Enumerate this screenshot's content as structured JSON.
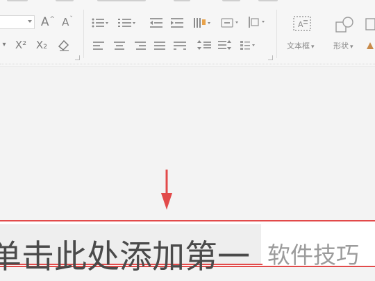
{
  "ribbon": {
    "font_group": {
      "font_size_value": "",
      "grow_font_label": "A",
      "shrink_font_label": "A",
      "superscript_label": "X²",
      "subscript_label": "X₂"
    },
    "insert_group": {
      "textbox_label": "文本框",
      "shape_label": "形状"
    }
  },
  "slide": {
    "title_placeholder": "单击此处添加第一",
    "watermark": "软件技巧"
  },
  "colors": {
    "highlight_border": "#e24a4a",
    "arrow": "#e24a4a",
    "ribbon_bg": "#f6f6f6",
    "canvas_bg": "#f3f3f3"
  }
}
